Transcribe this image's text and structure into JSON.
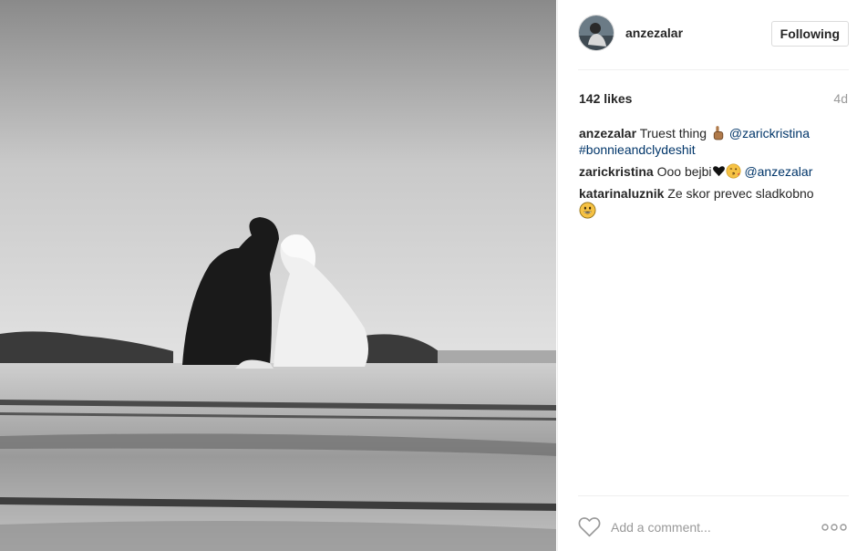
{
  "post": {
    "author": "anzezalar",
    "follow_label": "Following",
    "likes": "142 likes",
    "age": "4d"
  },
  "comments": [
    {
      "user": "anzezalar",
      "text": "Truest thing",
      "emoji": "index-pointing-up",
      "mention": "@zarickristina",
      "hashtag": "#bonnieandclydeshit"
    },
    {
      "user": "zarickristina",
      "text": "Ooo bejbi",
      "emoji": "black-heart + face-throwing-kiss",
      "mention": "@anzezalar"
    },
    {
      "user": "katarinaluznik",
      "text": "Ze skor prevec sladkobno",
      "emoji": "grinning-face"
    }
  ],
  "footer": {
    "comment_placeholder": "Add a comment..."
  },
  "colors": {
    "link": "#003569",
    "muted": "#999999",
    "text": "#262626",
    "border": "#dbdbdb"
  },
  "icons": {
    "like": "heart-outline-icon",
    "more": "more-options-icon"
  }
}
